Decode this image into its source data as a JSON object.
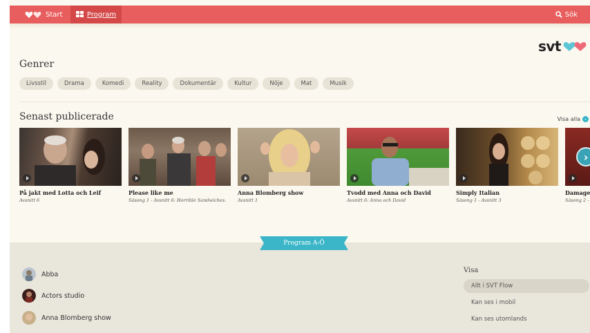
{
  "topbar": {
    "start_label": "Start",
    "program_label": "Program",
    "search_label": "Sök"
  },
  "brand": {
    "logo_text": "svt"
  },
  "genres": {
    "title": "Genrer",
    "items": [
      "Livsstil",
      "Drama",
      "Komedi",
      "Reality",
      "Dokumentär",
      "Kultur",
      "Nöje",
      "Mat",
      "Musik"
    ]
  },
  "latest": {
    "title": "Senast publicerade",
    "see_all": "Visa alla",
    "cards": [
      {
        "title": "På jakt med Lotta och Leif",
        "subtitle": "Avsnitt 6"
      },
      {
        "title": "Please like me",
        "subtitle": "Säsong 1 - Avsnitt 6: Horrible Sandwiches."
      },
      {
        "title": "Anna Blomberg show",
        "subtitle": "Avsnitt 1"
      },
      {
        "title": "Tvodd med Anna och David",
        "subtitle": "Avsnitt 6: Anna och David"
      },
      {
        "title": "Simply Italian",
        "subtitle": "Säsong 1 - Avsnitt 3"
      },
      {
        "title": "Damages",
        "subtitle": "Säsong 2 -"
      }
    ]
  },
  "az": {
    "banner": "Program A-Ö",
    "programs": [
      "Abba",
      "Actors studio",
      "Anna Blomberg show"
    ]
  },
  "visa": {
    "title": "Visa",
    "filters": [
      "Allt i SVT Flow",
      "Kan ses i mobil",
      "Kan ses utomlands"
    ]
  },
  "colors": {
    "brand_red": "#e85d5d",
    "accent_teal": "#37b4c6"
  }
}
